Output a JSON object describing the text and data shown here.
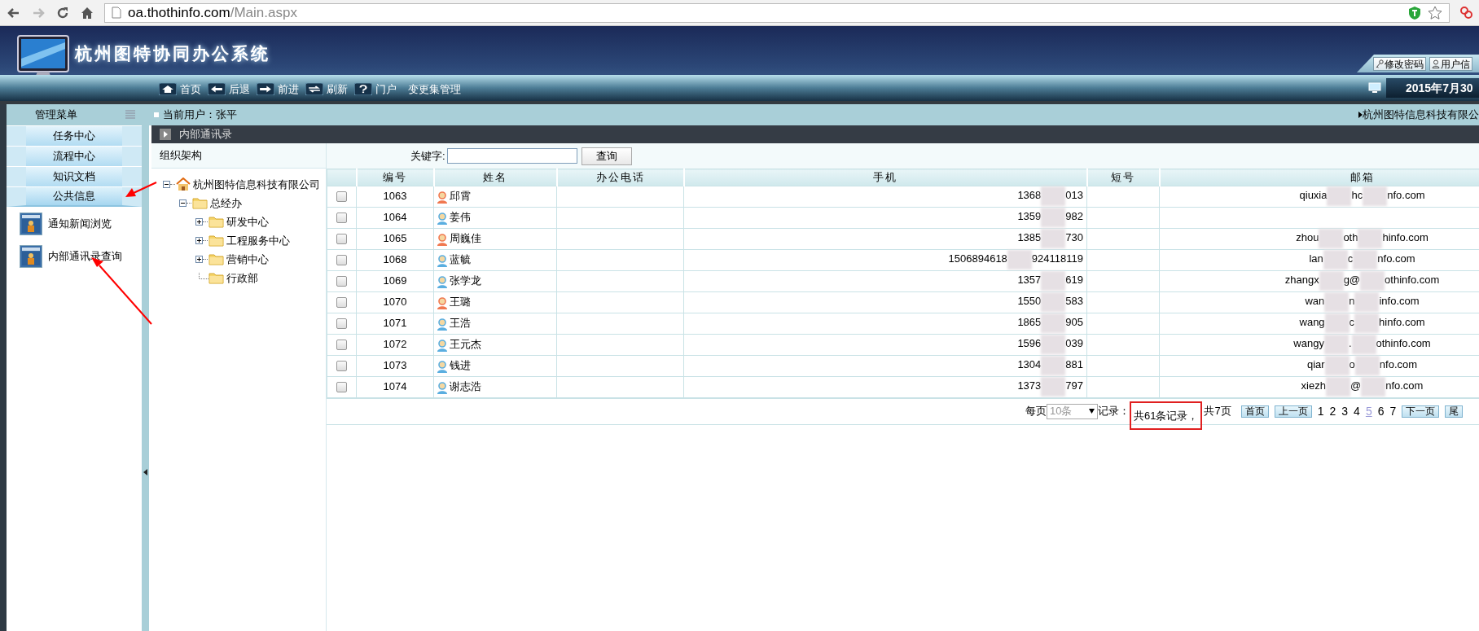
{
  "browser": {
    "url_host": "oa.thothinfo.com",
    "url_path": "/Main.aspx"
  },
  "header": {
    "title": "杭州图特协同办公系统",
    "nav": [
      {
        "label": "首页",
        "kind": "home"
      },
      {
        "label": "后退",
        "kind": "back"
      },
      {
        "label": "前进",
        "kind": "forward"
      },
      {
        "label": "刷新",
        "kind": "refresh"
      },
      {
        "label": "门户",
        "kind": "help"
      },
      {
        "label": "变更集管理",
        "kind": "plain"
      }
    ],
    "user_buttons": [
      {
        "label": "修改密码",
        "kind": "key"
      },
      {
        "label": "用户信",
        "kind": "user"
      }
    ],
    "date": "2015年7月30"
  },
  "sidebar": {
    "title": "管理菜单",
    "menu": [
      {
        "label": "任务中心",
        "expanded": false
      },
      {
        "label": "流程中心",
        "expanded": false
      },
      {
        "label": "知识文档",
        "expanded": false
      },
      {
        "label": "公共信息",
        "expanded": true
      }
    ],
    "items": [
      {
        "label": "通知新闻浏览"
      },
      {
        "label": "内部通讯录查询"
      }
    ]
  },
  "user_bar": {
    "current_user": "当前用户：张平",
    "company": "杭州图特信息科技有限公"
  },
  "panel_title": "内部通讯录",
  "org": {
    "title": "组织架构",
    "tree": [
      {
        "label": "杭州图特信息科技有限公司",
        "kind": "company",
        "expanded": true,
        "children": [
          {
            "label": "总经办",
            "kind": "folder",
            "expanded": true,
            "children": [
              {
                "label": "研发中心",
                "kind": "folder",
                "expanded": false
              },
              {
                "label": "工程服务中心",
                "kind": "folder",
                "expanded": false
              },
              {
                "label": "营销中心",
                "kind": "folder",
                "expanded": false
              },
              {
                "label": "行政部",
                "kind": "folder"
              }
            ]
          }
        ]
      }
    ]
  },
  "search": {
    "label": "关键字:",
    "button": "查询"
  },
  "table": {
    "columns": [
      "编号",
      "姓名",
      "办公电话",
      "手机",
      "短号",
      "邮箱"
    ],
    "rows": [
      {
        "checked": false,
        "id": "1063",
        "name": "邱霄",
        "color": "#f07850",
        "phone": [
          "1368",
          "013"
        ],
        "email": [
          "qiuxia",
          "hc",
          "nfo.com"
        ]
      },
      {
        "checked": false,
        "id": "1064",
        "name": "姜伟",
        "color": "#5aaee0",
        "phone": [
          "1359",
          "982"
        ]
      },
      {
        "checked": false,
        "id": "1065",
        "name": "周巍佳",
        "color": "#f07850",
        "phone": [
          "1385",
          "730"
        ],
        "email": [
          "zhou",
          "oth",
          "hinfo.com"
        ]
      },
      {
        "checked": false,
        "id": "1068",
        "name": "蓝毓",
        "color": "#5aaee0",
        "phone": [
          "1506894618",
          "924118119"
        ],
        "email": [
          "lan",
          "c",
          "nfo.com"
        ]
      },
      {
        "checked": false,
        "id": "1069",
        "name": "张学龙",
        "color": "#5aaee0",
        "phone": [
          "1357",
          "619"
        ],
        "email": [
          "zhangx",
          "g@",
          "othinfo.com"
        ]
      },
      {
        "checked": false,
        "id": "1070",
        "name": "王璐",
        "color": "#f07850",
        "phone": [
          "1550",
          "583"
        ],
        "email": [
          "wan",
          "n",
          "info.com"
        ]
      },
      {
        "checked": false,
        "id": "1071",
        "name": "王浩",
        "color": "#5aaee0",
        "phone": [
          "1865",
          "905"
        ],
        "email": [
          "wang",
          "c",
          "hinfo.com"
        ]
      },
      {
        "checked": false,
        "id": "1072",
        "name": "王元杰",
        "color": "#5aaee0",
        "phone": [
          "1596",
          "039"
        ],
        "email": [
          "wangy",
          ".",
          "othinfo.com"
        ]
      },
      {
        "checked": false,
        "id": "1073",
        "name": "钱进",
        "color": "#5aaee0",
        "phone": [
          "1304",
          "881"
        ],
        "email": [
          "qiar",
          "o",
          "nfo.com"
        ]
      },
      {
        "checked": false,
        "id": "1074",
        "name": "谢志浩",
        "color": "#5aaee0",
        "phone": [
          "1373",
          "797"
        ],
        "email": [
          "xiezh",
          "@",
          "nfo.com"
        ]
      }
    ]
  },
  "pager": {
    "per_page_label": "每页",
    "per_page": "10条",
    "records_label": "记录：",
    "total": "共61条记录，",
    "pages_total": "共7页",
    "first": "首页",
    "prev": "上一页",
    "pages": [
      {
        "label": "1",
        "selected": false
      },
      {
        "label": "2",
        "selected": false
      },
      {
        "label": "3",
        "selected": false
      },
      {
        "label": "4",
        "selected": false
      },
      {
        "label": "5",
        "selected": true
      },
      {
        "label": "6",
        "selected": false
      },
      {
        "label": "7",
        "selected": false
      }
    ],
    "next": "下一页",
    "last": "尾"
  }
}
